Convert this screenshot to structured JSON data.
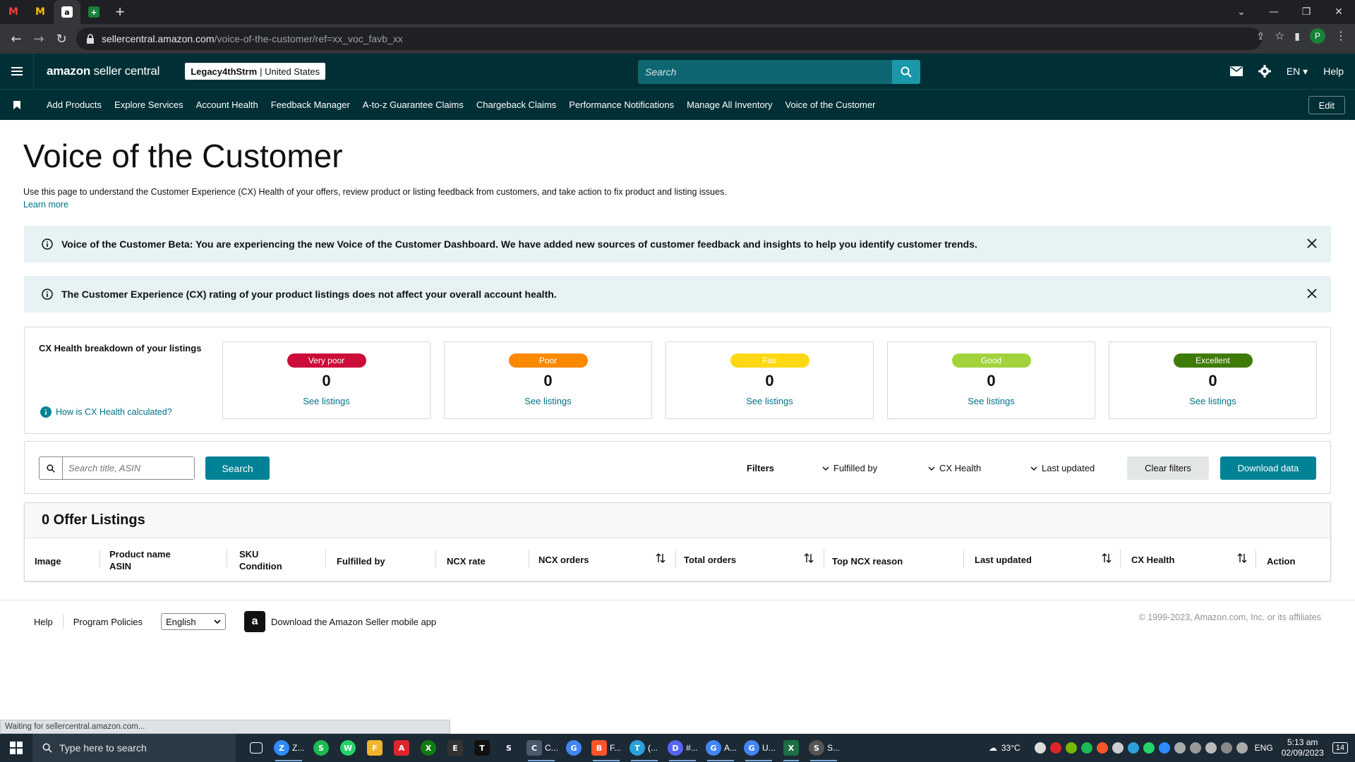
{
  "browser": {
    "tabs": [
      {
        "icon": "gmail-icon",
        "glyph": "M",
        "color": "#ea4335"
      },
      {
        "icon": "gmail-icon",
        "glyph": "M",
        "color": "#ea4335"
      },
      {
        "icon": "amazon-icon",
        "glyph": "a",
        "color": "#ffffff",
        "active": true
      },
      {
        "icon": "sheets-icon",
        "glyph": "+",
        "color": "#188038"
      }
    ],
    "new_tab": "+",
    "url_host": "sellercentral.amazon.com",
    "url_path": "/voice-of-the-customer/ref=xx_voc_favb_xx",
    "profile_initial": "P"
  },
  "header": {
    "logo_bold": "amazon",
    "logo_rest": "seller central",
    "account_name": "Legacy4thStrm",
    "account_region": "| United States",
    "search_placeholder": "Search",
    "language": "EN",
    "help": "Help"
  },
  "nav": {
    "items": [
      "Add Products",
      "Explore Services",
      "Account Health",
      "Feedback Manager",
      "A-to-z Guarantee Claims",
      "Chargeback Claims",
      "Performance Notifications",
      "Manage All Inventory",
      "Voice of the Customer"
    ],
    "edit": "Edit"
  },
  "page": {
    "title": "Voice of the Customer",
    "intro": "Use this page to understand the Customer Experience (CX) Health of your offers, review product or listing feedback from customers, and take action to fix product and listing issues.",
    "learn_more": "Learn more",
    "banner_beta": "Voice of the Customer Beta: You are experiencing the new Voice of the Customer Dashboard. We have added new sources of customer feedback and insights to help you identify customer trends.",
    "banner_cx": "The Customer Experience (CX) rating of your product listings does not affect your overall account health."
  },
  "cx_health": {
    "label": "CX Health breakdown of your listings",
    "help_link": "How is CX Health calculated?",
    "cards": [
      {
        "rating": "Very poor",
        "count": "0",
        "link": "See listings",
        "color": "#cc0c39"
      },
      {
        "rating": "Poor",
        "count": "0",
        "link": "See listings",
        "color": "#fa8900"
      },
      {
        "rating": "Fair",
        "count": "0",
        "link": "See listings",
        "color": "#ffd814"
      },
      {
        "rating": "Good",
        "count": "0",
        "link": "See listings",
        "color": "#a2d33c"
      },
      {
        "rating": "Excellent",
        "count": "0",
        "link": "See listings",
        "color": "#3f7b08"
      }
    ]
  },
  "filters": {
    "search_placeholder": "Search title, ASIN",
    "search_button": "Search",
    "label": "Filters",
    "fulfilled_by": "Fulfilled by",
    "cx_health": "CX Health",
    "last_updated": "Last updated",
    "clear": "Clear filters",
    "download": "Download data"
  },
  "listings": {
    "title": "0 Offer Listings",
    "columns": {
      "image": "Image",
      "product_name": "Product name",
      "asin": "ASIN",
      "sku": "SKU",
      "condition": "Condition",
      "fulfilled_by": "Fulfilled by",
      "ncx_rate": "NCX rate",
      "ncx_orders": "NCX orders",
      "total_orders": "Total orders",
      "top_ncx_reason": "Top NCX reason",
      "last_updated": "Last updated",
      "cx_health": "CX Health",
      "action": "Action"
    }
  },
  "footer": {
    "help": "Help",
    "policies": "Program Policies",
    "language": "English",
    "app_download": "Download the Amazon Seller mobile app",
    "copyright": "© 1999-2023, Amazon.com, Inc. or its affiliates"
  },
  "status_bar": "Waiting for sellercentral.amazon.com...",
  "taskbar": {
    "search_placeholder": "Type here to search",
    "apps": [
      {
        "name": "zoom-app",
        "glyph": "Z",
        "color": "#2d8cff",
        "label": "Z..."
      },
      {
        "name": "spotify-app",
        "glyph": "S",
        "color": "#1db954"
      },
      {
        "name": "whatsapp-app",
        "glyph": "W",
        "color": "#25d366"
      },
      {
        "name": "explorer-app",
        "glyph": "F",
        "color": "#f0b429"
      },
      {
        "name": "amd-app",
        "glyph": "A",
        "color": "#e0242b"
      },
      {
        "name": "xbox-app",
        "glyph": "X",
        "color": "#107c10"
      },
      {
        "name": "epic-app",
        "glyph": "E",
        "color": "#333333"
      },
      {
        "name": "tiktok-app",
        "glyph": "T",
        "color": "#111111"
      },
      {
        "name": "steam-app",
        "glyph": "S",
        "color": "#1b2838"
      },
      {
        "name": "calculator-app",
        "glyph": "C",
        "color": "#4a5a6a",
        "label": "C..."
      },
      {
        "name": "chrome-app",
        "glyph": "G",
        "color": "#4285f4"
      },
      {
        "name": "brave-app",
        "glyph": "B",
        "color": "#fb542b",
        "label": "F..."
      },
      {
        "name": "telegram-app",
        "glyph": "T",
        "color": "#2aa1da",
        "label": "(..."
      },
      {
        "name": "discord-app",
        "glyph": "D",
        "color": "#5865f2",
        "label": "#..."
      },
      {
        "name": "chrome-app-2",
        "glyph": "G",
        "color": "#4285f4",
        "label": "A..."
      },
      {
        "name": "chrome-app-3",
        "glyph": "G",
        "color": "#4285f4",
        "label": "U..."
      },
      {
        "name": "excel-app",
        "glyph": "X",
        "color": "#1d6f42"
      },
      {
        "name": "clock-app",
        "glyph": "S",
        "color": "#555555",
        "label": "S..."
      }
    ],
    "weather": "33°C",
    "lang": "ENG",
    "time": "5:13 am",
    "date": "02/09/2023",
    "notifications": "14"
  }
}
